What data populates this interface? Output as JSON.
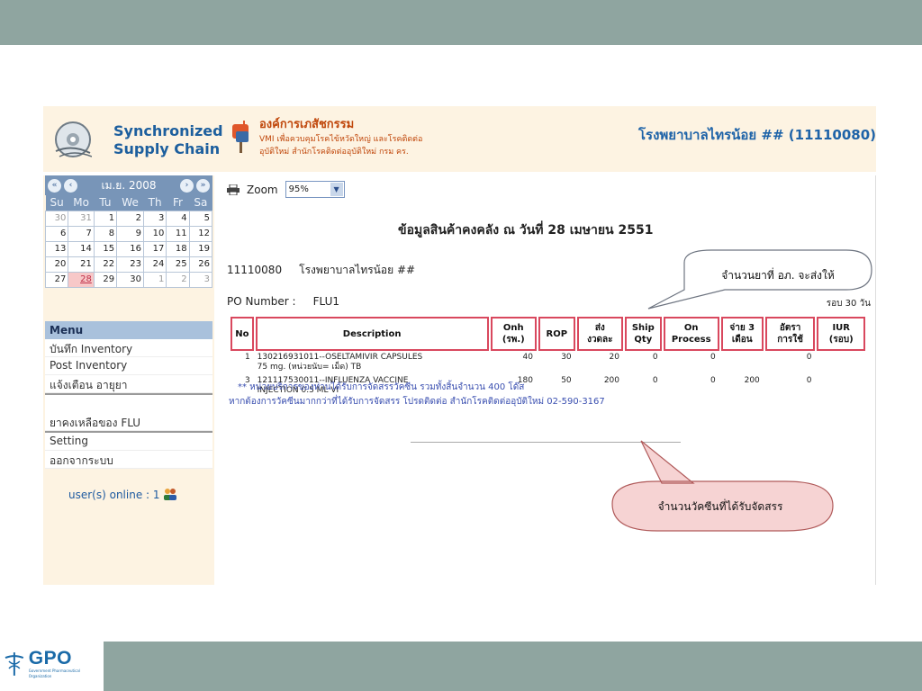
{
  "header": {
    "sc_line1": "Synchronized",
    "sc_line2": "Supply Chain",
    "org_name": "องค์การเภสัชกรรม",
    "org_sub1": "VMI เพื่อควบคุมโรคไข้หวัดใหญ่ และโรคติดต่อ",
    "org_sub2": "อุบัติใหม่ สำนักโรคติดต่ออุบัติใหม่ กรม คร.",
    "hospital_title": "โรงพยาบาลไทรน้อย ## (11110080)"
  },
  "calendar": {
    "title": "เม.ย. 2008",
    "weekdays": [
      "Su",
      "Mo",
      "Tu",
      "We",
      "Th",
      "Fr",
      "Sa"
    ],
    "weeks": [
      [
        "30",
        "31",
        "1",
        "2",
        "3",
        "4",
        "5"
      ],
      [
        "6",
        "7",
        "8",
        "9",
        "10",
        "11",
        "12"
      ],
      [
        "13",
        "14",
        "15",
        "16",
        "17",
        "18",
        "19"
      ],
      [
        "20",
        "21",
        "22",
        "23",
        "24",
        "25",
        "26"
      ],
      [
        "27",
        "28",
        "29",
        "30",
        "1",
        "2",
        "3"
      ]
    ],
    "today": "28"
  },
  "menu": {
    "title": "Menu",
    "item_record_inventory": "บันทึก Inventory",
    "item_post_inventory": "Post Inventory",
    "item_expiry_alert": "แจ้งเตือน อายุยา",
    "item_flu_stock": "ยาคงเหลือของ FLU",
    "item_setting": "Setting",
    "item_logout": "ออกจากระบบ",
    "online_text": "user(s) online : 1"
  },
  "toolbar": {
    "zoom_label": "Zoom",
    "zoom_value": "95%"
  },
  "report": {
    "title": "ข้อมูลสินค้าคงคลัง ณ วันที่  28 เมษายน 2551",
    "hospital_code": "11110080",
    "hospital_name": "โรงพยาบาลไทรน้อย ##",
    "po_label": "PO Number :",
    "po_value": "FLU1",
    "round_label": "รอบ 30 วัน",
    "columns": {
      "no": "No",
      "description": "Description",
      "onh_1": "Onh",
      "onh_2": "(รพ.)",
      "rop": "ROP",
      "send_1": "ส่ง",
      "send_2": "งวดละ",
      "ship_1": "Ship",
      "ship_2": "Qty",
      "onproc_1": "On",
      "onproc_2": "Process",
      "pay_1": "จ่าย 3",
      "pay_2": "เดือน",
      "rate_1": "อัตรา",
      "rate_2": "การใช้",
      "iur_1": "IUR",
      "iur_2": "(รอบ)"
    },
    "rows": [
      {
        "no": "1",
        "desc1": "130216931011--OSELTAMIVIR CAPSULES",
        "desc2": "75 mg. (หน่วยนับ= เม็ด)  TB",
        "onh": "40",
        "rop": "30",
        "send": "20",
        "ship": "0",
        "onproc": "0",
        "pay": "",
        "rate": "0"
      },
      {
        "no": "3",
        "desc1": "121117530011--INFLUENZA VACCINE",
        "desc2": "INJECTION 0.5 ML  VI",
        "onh": "180",
        "rop": "50",
        "send": "200",
        "ship": "0",
        "onproc": "0",
        "pay": "200",
        "rate": "0"
      }
    ],
    "note1": "** หน่วยบริการของท่านได้รับการจัดสรรวัคซีน รวมทั้งสิ้นจำนวน 400 โด๊ส",
    "note2": "หากต้องการวัคซีนมากกว่าที่ได้รับการจัดสรร โปรดติดต่อ สำนักโรคติดต่ออุบัติใหม่ 02-590-3167"
  },
  "callouts": {
    "ship_note": "จำนวนยาที่ อภ. จะส่งให้",
    "vaccine_note": "จำนวนวัคซีนที่ได้รับจัดสรร"
  },
  "footer": {
    "logo_text": "GPO",
    "logo_sub": "Government Pharmaceutical Organization"
  },
  "colors": {
    "frame": "#8fa5a0",
    "header_bg": "#fdf3e2",
    "accent_blue": "#1e63a8",
    "accent_orange": "#c0470b",
    "table_border": "#d9485e",
    "callout_fill": "#f6d3d3"
  }
}
